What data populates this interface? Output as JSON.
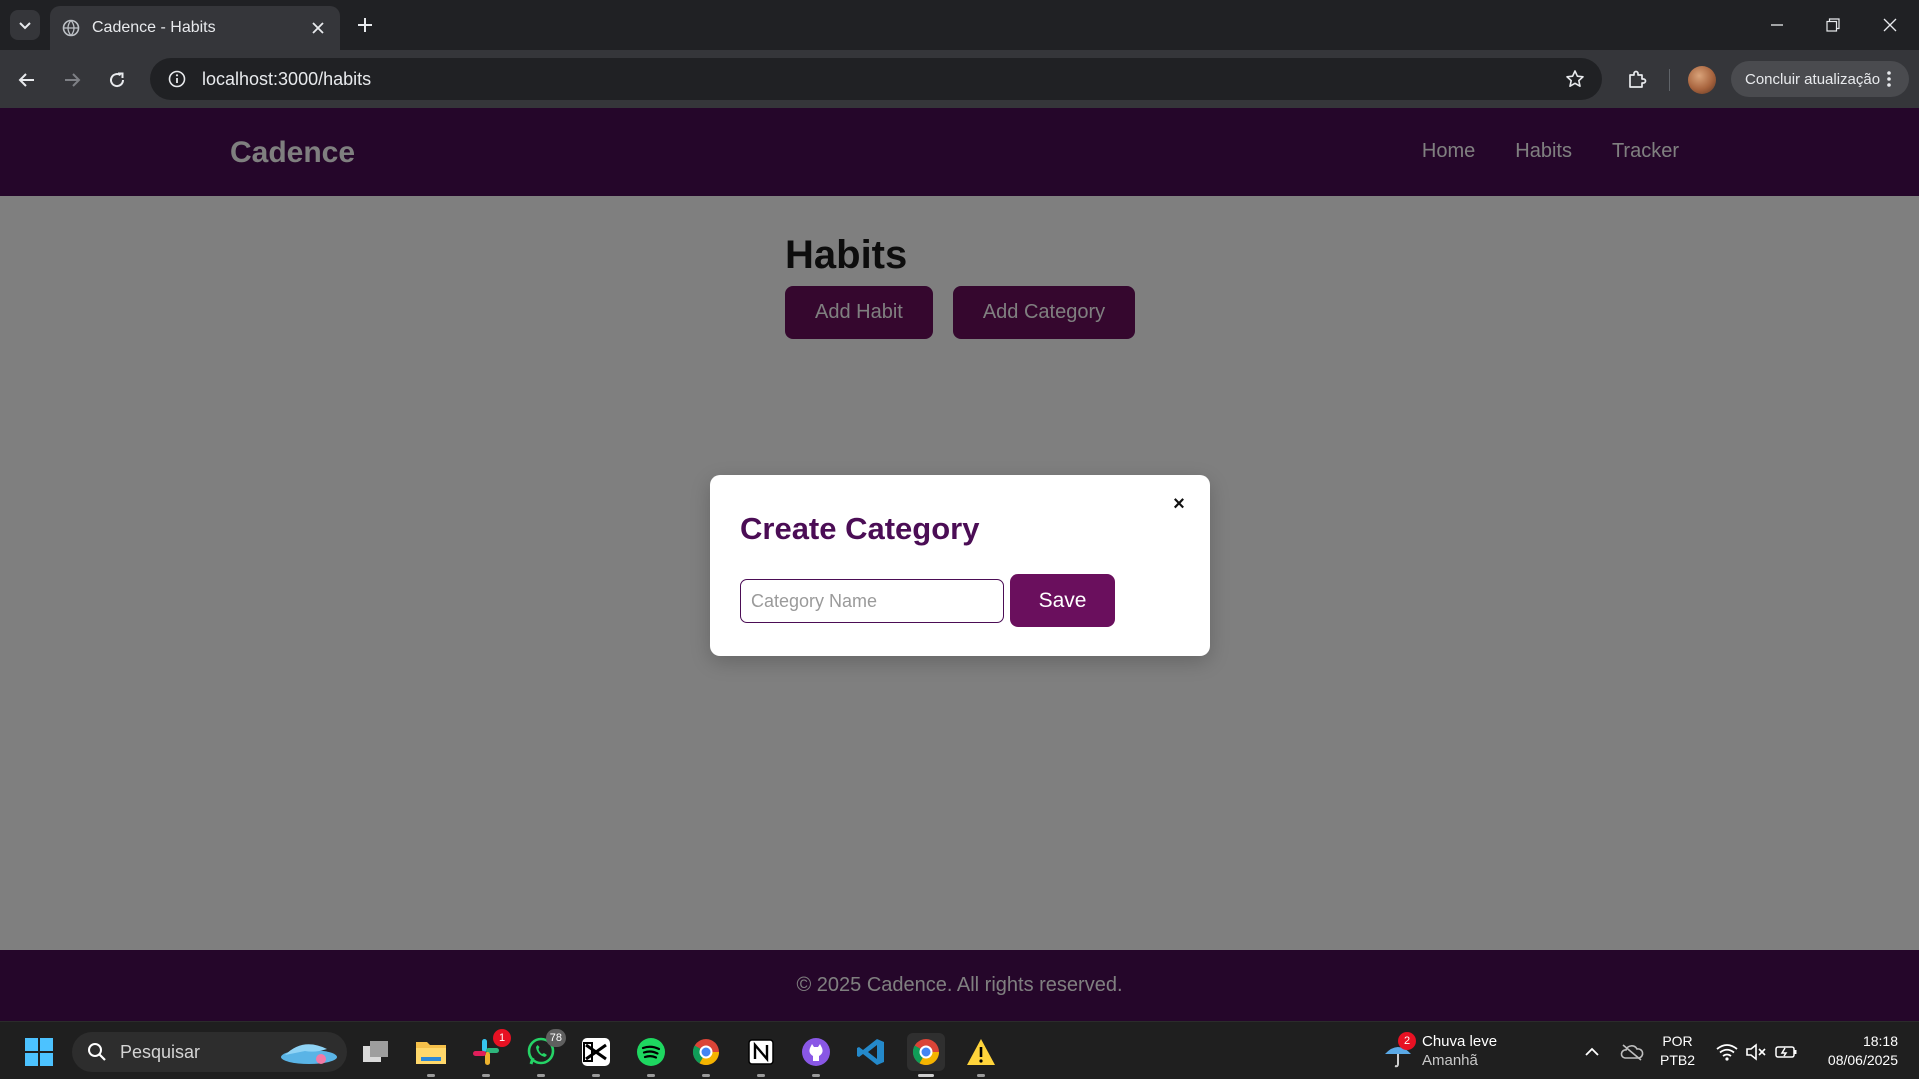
{
  "browser": {
    "tab_title": "Cadence - Habits",
    "url": "localhost:3000/habits",
    "update_label": "Concluir atualização"
  },
  "app": {
    "brand": "Cadence",
    "nav": [
      "Home",
      "Habits",
      "Tracker"
    ],
    "heading": "Habits",
    "add_habit_label": "Add Habit",
    "add_category_label": "Add Category",
    "footer_text": "© 2025 Cadence. All rights reserved.",
    "colors": {
      "primary": "#4b0d55",
      "button": "#6a0f5d"
    }
  },
  "modal": {
    "title": "Create Category",
    "close_glyph": "×",
    "input_placeholder": "Category Name",
    "input_value": "",
    "save_label": "Save"
  },
  "taskbar": {
    "search_placeholder": "Pesquisar",
    "slack_badge": "1",
    "whatsapp_badge": "78",
    "weather_badge": "2",
    "weather_line1": "Chuva leve",
    "weather_line2": "Amanhã",
    "lang_line1": "POR",
    "lang_line2": "PTB2",
    "time": "18:18",
    "date": "08/06/2025"
  }
}
